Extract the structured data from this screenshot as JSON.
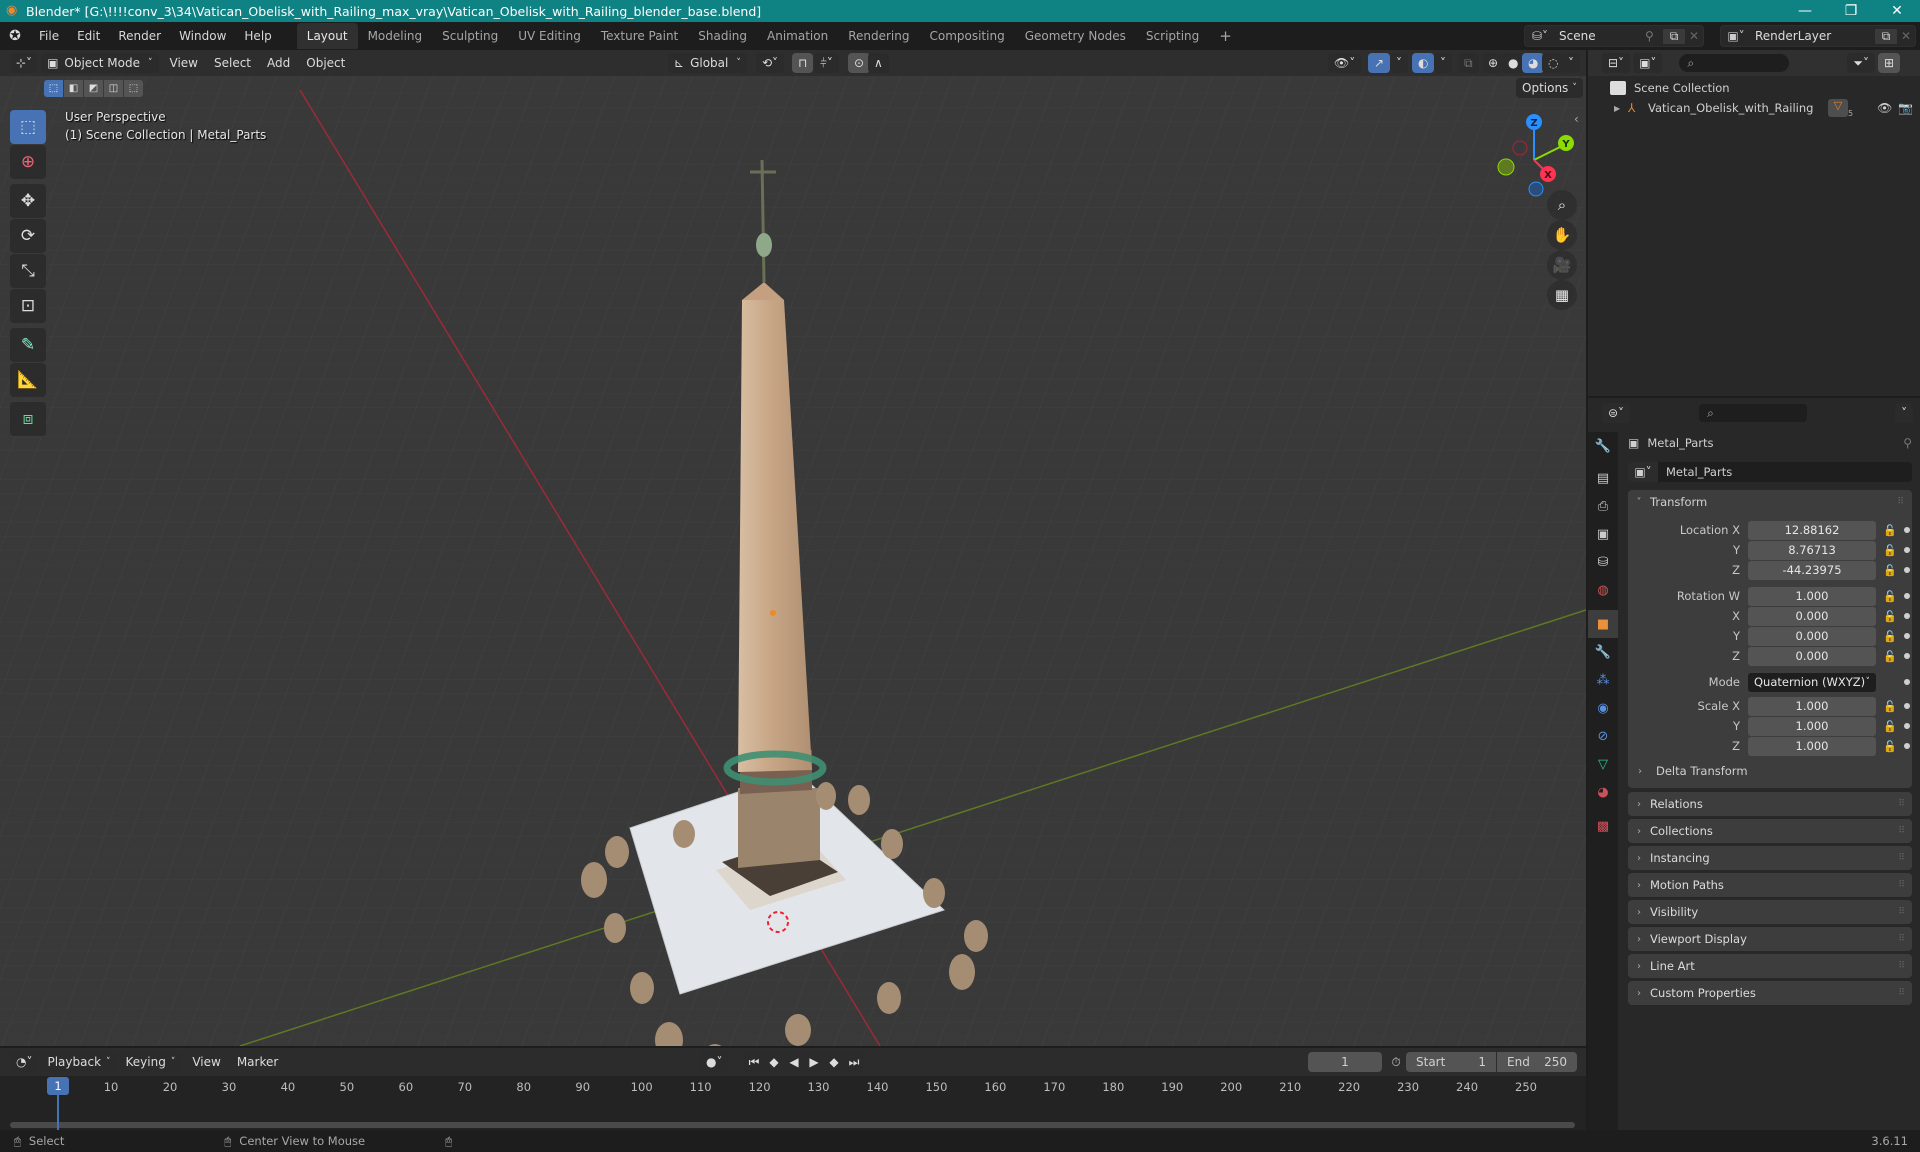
{
  "window": {
    "title": "Blender* [G:\\!!!!conv_3\\34\\Vatican_Obelisk_with_Railing_max_vray\\Vatican_Obelisk_with_Railing_blender_base.blend]",
    "controls": {
      "minimize": "—",
      "maximize": "❐",
      "close": "✕"
    }
  },
  "menubar": {
    "menus": [
      "File",
      "Edit",
      "Render",
      "Window",
      "Help"
    ],
    "workspaces": [
      {
        "label": "Layout",
        "active": true
      },
      {
        "label": "Modeling"
      },
      {
        "label": "Sculpting"
      },
      {
        "label": "UV Editing"
      },
      {
        "label": "Texture Paint"
      },
      {
        "label": "Shading"
      },
      {
        "label": "Animation"
      },
      {
        "label": "Rendering"
      },
      {
        "label": "Compositing"
      },
      {
        "label": "Geometry Nodes"
      },
      {
        "label": "Scripting"
      }
    ],
    "add_workspace": "+",
    "scene": "Scene",
    "view_layer": "RenderLayer"
  },
  "viewport": {
    "mode": "Object Mode",
    "menus": [
      "View",
      "Select",
      "Add",
      "Object"
    ],
    "orientation": "Global",
    "options_label": "Options",
    "overlay_text": {
      "line1": "User Perspective",
      "line2": "(1) Scene Collection | Metal_Parts"
    },
    "gizmo_axes": {
      "x": "X",
      "y": "Y",
      "z": "Z"
    },
    "colors": {
      "x_axis": "#ff3352",
      "y_axis": "#8bdc00",
      "z_axis": "#2890ff",
      "selection": "#4772b3"
    },
    "tools": [
      "select-box",
      "cursor",
      "move",
      "rotate",
      "scale",
      "transform",
      "annotate",
      "measure",
      "add-cube"
    ]
  },
  "outliner": {
    "root": "Scene Collection",
    "items": [
      {
        "label": "Vatican_Obelisk_with_Railing",
        "badge": "5"
      }
    ]
  },
  "properties": {
    "object_name": "Metal_Parts",
    "data_name": "Metal_Parts",
    "transform": {
      "title": "Transform",
      "location": {
        "label": "Location X",
        "x": "12.88162",
        "y": "8.76713",
        "z": "-44.23975"
      },
      "rotation": {
        "label": "Rotation W",
        "w": "1.000",
        "x": "0.000",
        "y": "0.000",
        "z": "0.000"
      },
      "mode_label": "Mode",
      "mode_value": "Quaternion (WXYZ)",
      "scale": {
        "label": "Scale X",
        "x": "1.000",
        "y": "1.000",
        "z": "1.000"
      },
      "axis_labels": {
        "y": "Y",
        "z": "Z",
        "x": "X"
      },
      "delta": "Delta Transform"
    },
    "panels": [
      "Relations",
      "Collections",
      "Instancing",
      "Motion Paths",
      "Visibility",
      "Viewport Display",
      "Line Art",
      "Custom Properties"
    ]
  },
  "timeline": {
    "menus": [
      "Playback",
      "Keying",
      "View",
      "Marker"
    ],
    "current_frame": "1",
    "start_label": "Start",
    "start": "1",
    "end_label": "End",
    "end": "250",
    "ticks": [
      "10",
      "20",
      "30",
      "40",
      "50",
      "60",
      "70",
      "80",
      "90",
      "100",
      "110",
      "120",
      "130",
      "140",
      "150",
      "160",
      "170",
      "180",
      "190",
      "200",
      "210",
      "220",
      "230",
      "240",
      "250"
    ]
  },
  "statusbar": {
    "select": "Select",
    "center_view": "Center View to Mouse",
    "version": "3.6.11"
  }
}
